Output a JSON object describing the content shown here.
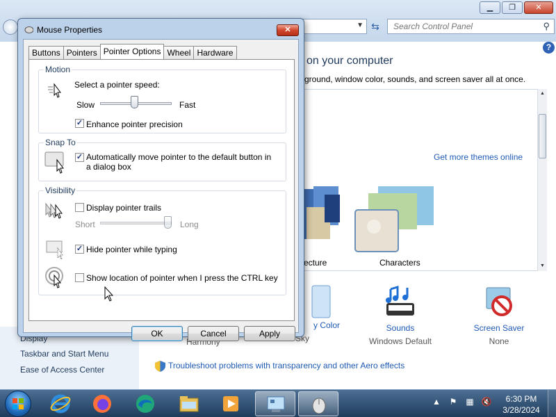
{
  "control_panel": {
    "search_placeholder": "Search Control Panel",
    "heading": "on your computer",
    "subtext": "kground, window color, sounds, and screen saver all at once.",
    "get_more": "Get more themes online",
    "themes": [
      {
        "label": "ecture"
      },
      {
        "label": "Characters"
      }
    ],
    "bottom_items": [
      {
        "link": "y Color",
        "sub": "Sky"
      },
      {
        "link": "Sounds",
        "sub": "Windows Default"
      },
      {
        "link": "Screen Saver",
        "sub": "None"
      }
    ],
    "harmony": "Harmony",
    "troubleshoot": "Troubleshoot problems with transparency and other Aero effects",
    "sidebar": [
      "Display",
      "Taskbar and Start Menu",
      "Ease of Access Center"
    ]
  },
  "dialog": {
    "title": "Mouse Properties",
    "close": "✕",
    "tabs": [
      "Buttons",
      "Pointers",
      "Pointer Options",
      "Wheel",
      "Hardware"
    ],
    "active_tab": "Pointer Options",
    "motion": {
      "legend": "Motion",
      "speed_label": "Select a pointer speed:",
      "slow": "Slow",
      "fast": "Fast",
      "speed_value": 0.5,
      "enhance_label": "Enhance pointer precision",
      "enhance_checked": true
    },
    "snap": {
      "legend": "Snap To",
      "label": "Automatically move pointer to the default button in a dialog box",
      "checked": true
    },
    "visibility": {
      "legend": "Visibility",
      "trails_label": "Display pointer trails",
      "trails_checked": false,
      "short": "Short",
      "long": "Long",
      "trails_value": 1.0,
      "hide_label": "Hide pointer while typing",
      "hide_checked": true,
      "ctrl_label": "Show location of pointer when I press the CTRL key",
      "ctrl_checked": false
    },
    "buttons": {
      "ok": "OK",
      "cancel": "Cancel",
      "apply": "Apply"
    }
  },
  "taskbar": {
    "time": "6:30 PM",
    "date": "3/28/2024",
    "apps": [
      "internet-explorer",
      "firefox",
      "edge",
      "file-explorer",
      "media-player",
      "control-panel",
      "mouse-properties"
    ]
  }
}
